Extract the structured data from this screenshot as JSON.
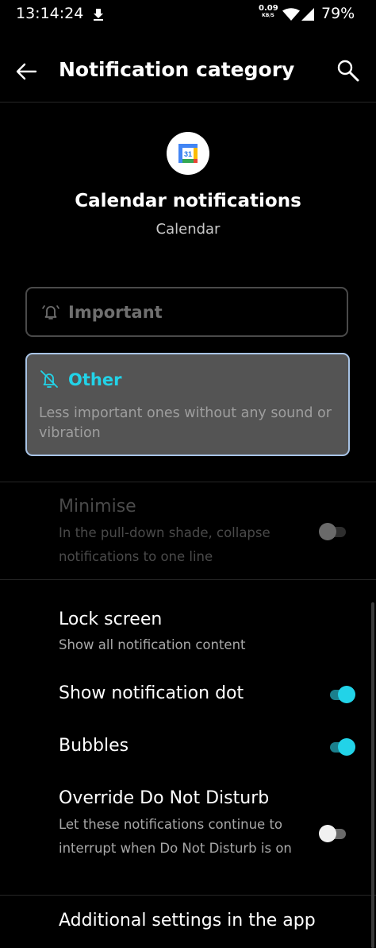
{
  "status_bar": {
    "time": "13:14:24",
    "net_speed_value": "0.09",
    "net_speed_unit": "KB/S",
    "battery": "79%"
  },
  "app_bar": {
    "title": "Notification category"
  },
  "header": {
    "app_icon_text": "31",
    "title": "Calendar notifications",
    "subtitle": "Calendar"
  },
  "importance": {
    "important_label": "Important",
    "other_label": "Other",
    "other_description": "Less important ones without any sound or vibration",
    "accent_color": "#22d3e8"
  },
  "settings": {
    "minimise": {
      "title": "Minimise",
      "subtitle": "In the pull-down shade, collapse notifications to one line",
      "enabled": false,
      "disabled": true
    },
    "lock_screen": {
      "title": "Lock screen",
      "subtitle": "Show all notification content"
    },
    "notification_dot": {
      "title": "Show notification dot",
      "enabled": true
    },
    "bubbles": {
      "title": "Bubbles",
      "enabled": true
    },
    "override_dnd": {
      "title": "Override Do Not Disturb",
      "subtitle": "Let these notifications continue to interrupt when Do Not Disturb is on",
      "enabled": false
    },
    "additional": {
      "title": "Additional settings in the app"
    }
  }
}
